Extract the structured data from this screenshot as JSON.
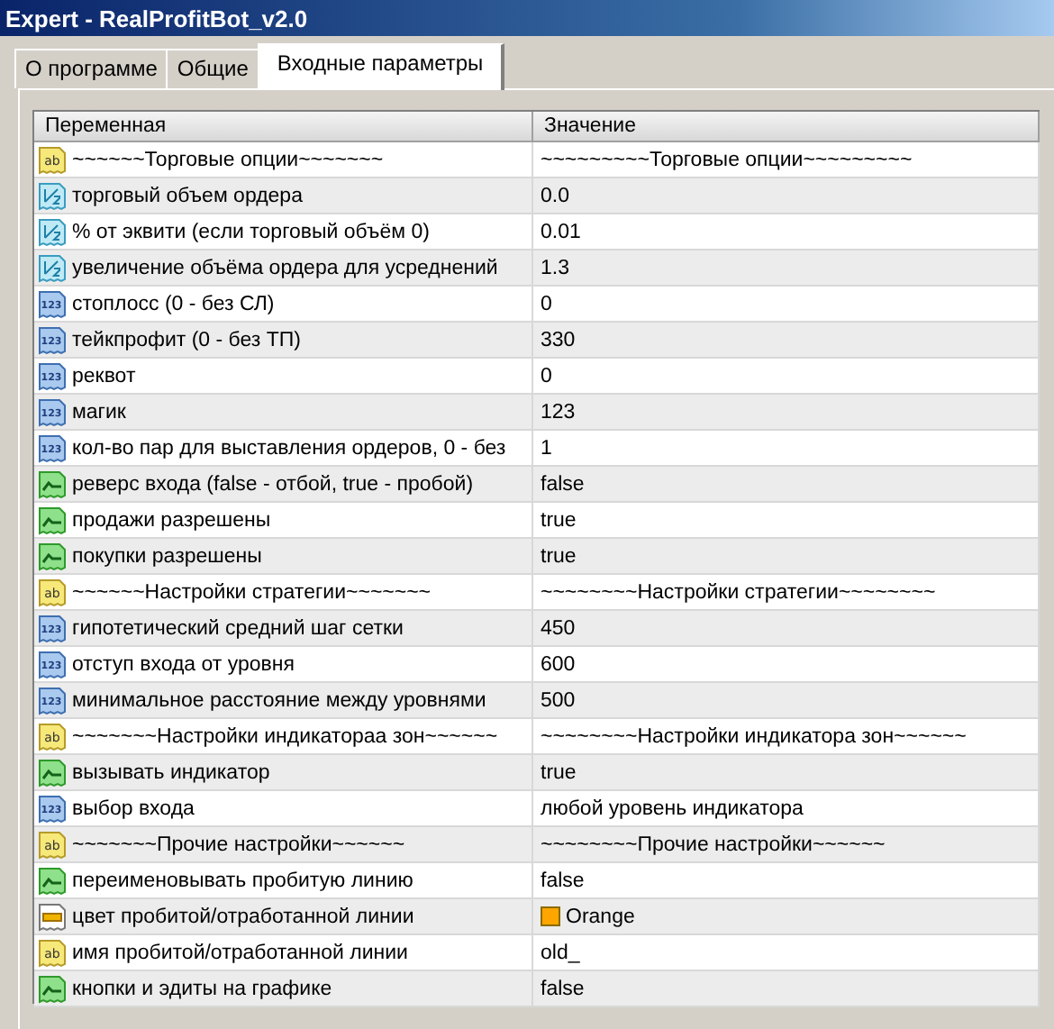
{
  "window": {
    "title": "Expert - RealProfitBot_v2.0"
  },
  "tabs": [
    {
      "label": "О программе",
      "selected": false
    },
    {
      "label": "Общие",
      "selected": false
    },
    {
      "label": "Входные параметры",
      "selected": true
    }
  ],
  "table": {
    "columns": [
      "Переменная",
      "Значение"
    ],
    "rows": [
      {
        "kind": "string",
        "icon_text": "ab",
        "name": "~~~~~~Торговые опции~~~~~~~",
        "value": "~~~~~~~~~Торговые опции~~~~~~~~~"
      },
      {
        "kind": "double",
        "name": "торговый объем ордера",
        "value": "0.0"
      },
      {
        "kind": "double",
        "name": "% от эквити (если торговый объём 0)",
        "value": "0.01"
      },
      {
        "kind": "double",
        "name": "увеличение объёма ордера для усреднений",
        "value": "1.3"
      },
      {
        "kind": "int",
        "icon_text": "123",
        "name": "стоплосс (0 - без СЛ)",
        "value": "0"
      },
      {
        "kind": "int",
        "icon_text": "123",
        "name": "тейкпрофит (0 - без ТП)",
        "value": "330"
      },
      {
        "kind": "int",
        "icon_text": "123",
        "name": "реквот",
        "value": "0"
      },
      {
        "kind": "int",
        "icon_text": "123",
        "name": "магик",
        "value": "123"
      },
      {
        "kind": "int",
        "icon_text": "123",
        "name": "кол-во пар для выставления ордеров, 0 - без",
        "value": "1"
      },
      {
        "kind": "bool",
        "name": "реверс входа (false - отбой, true - пробой)",
        "value": "false"
      },
      {
        "kind": "bool",
        "name": "продажи разрешены",
        "value": "true"
      },
      {
        "kind": "bool",
        "name": "покупки разрешены",
        "value": "true"
      },
      {
        "kind": "string",
        "icon_text": "ab",
        "name": "~~~~~~Настройки стратегии~~~~~~~",
        "value": "~~~~~~~~Настройки стратегии~~~~~~~~"
      },
      {
        "kind": "int",
        "icon_text": "123",
        "name": "гипотетический средний шаг сетки",
        "value": "450"
      },
      {
        "kind": "int",
        "icon_text": "123",
        "name": "отступ входа от уровня",
        "value": "600"
      },
      {
        "kind": "int",
        "icon_text": "123",
        "name": "минимальное расстояние между уровнями",
        "value": "500"
      },
      {
        "kind": "string",
        "icon_text": "ab",
        "name": "~~~~~~~Настройки индикатораа зон~~~~~~",
        "value": "~~~~~~~~Настройки индикатора зон~~~~~~"
      },
      {
        "kind": "bool",
        "name": "вызывать индикатор",
        "value": "true"
      },
      {
        "kind": "int",
        "icon_text": "123",
        "name": "выбор входа",
        "value": "любой уровень индикатора"
      },
      {
        "kind": "string",
        "icon_text": "ab",
        "name": "~~~~~~~Прочие настройки~~~~~~",
        "value": "~~~~~~~~Прочие настройки~~~~~~"
      },
      {
        "kind": "bool",
        "name": "переименовывать пробитую линию",
        "value": "false"
      },
      {
        "kind": "color",
        "name": "цвет пробитой/отработанной линии",
        "value": "Orange",
        "color": "#ffa500"
      },
      {
        "kind": "string",
        "icon_text": "ab",
        "name": "имя пробитой/отработанной линии",
        "value": "old_"
      },
      {
        "kind": "bool",
        "name": "кнопки и эдиты на графике",
        "value": "false"
      }
    ]
  }
}
